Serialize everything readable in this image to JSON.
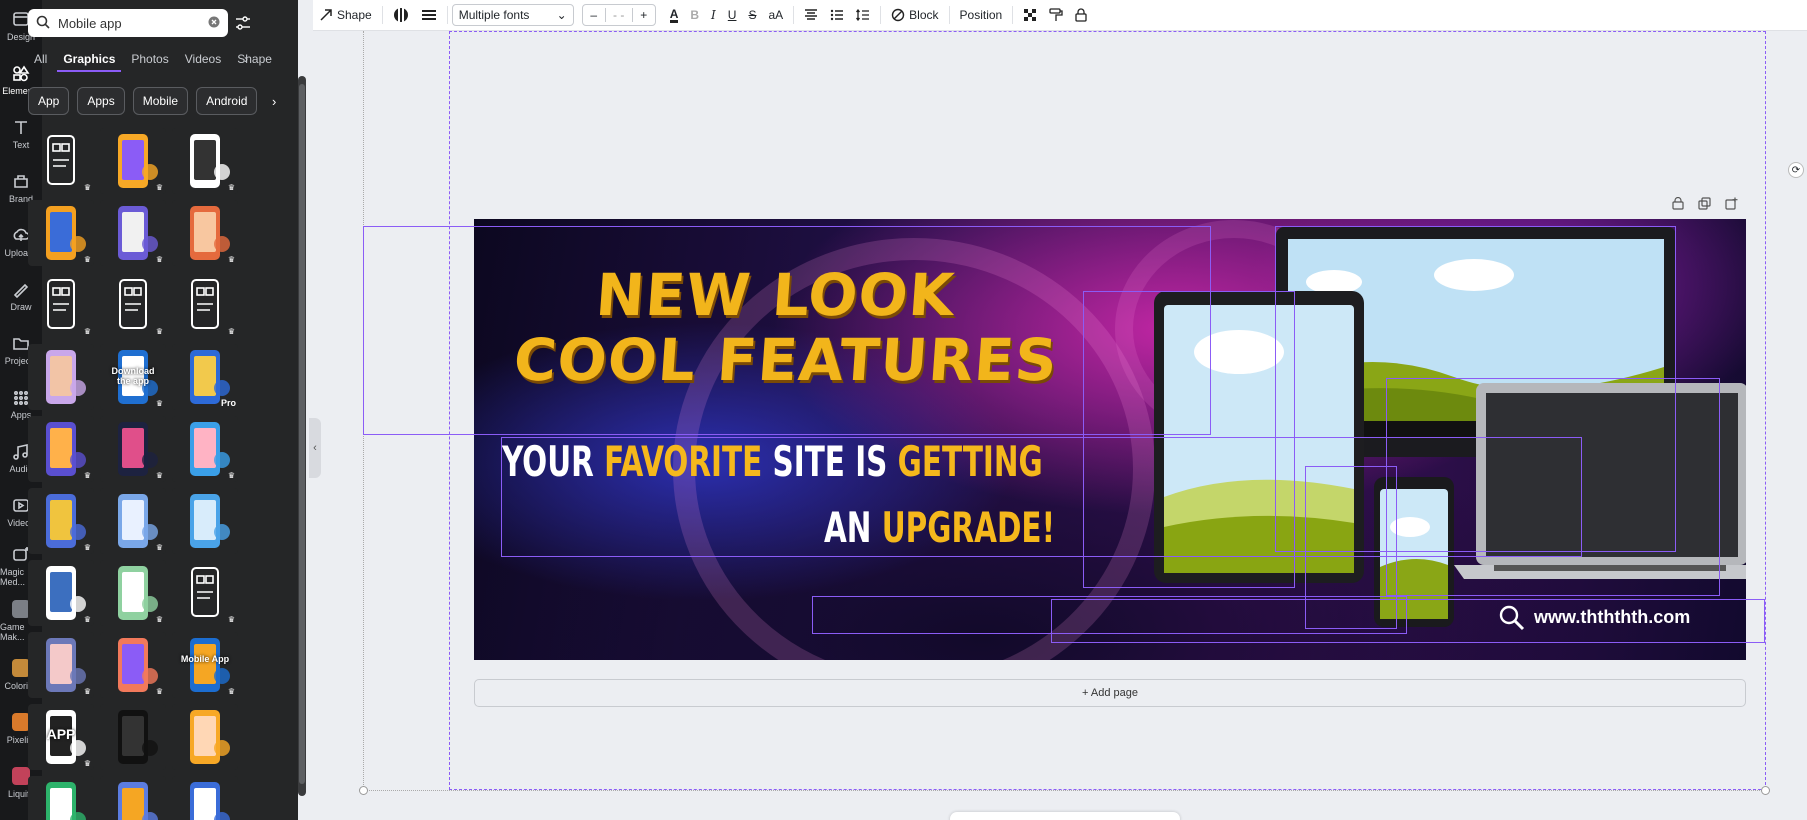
{
  "rail": {
    "items": [
      {
        "label": "Design",
        "icon": "design-icon"
      },
      {
        "label": "Elements",
        "icon": "elements-icon"
      },
      {
        "label": "Text",
        "icon": "text-icon"
      },
      {
        "label": "Brand",
        "icon": "brand-icon"
      },
      {
        "label": "Uploads",
        "icon": "uploads-icon"
      },
      {
        "label": "Draw",
        "icon": "draw-icon"
      },
      {
        "label": "Projects",
        "icon": "projects-icon"
      },
      {
        "label": "Apps",
        "icon": "apps-icon"
      },
      {
        "label": "Audio",
        "icon": "audio-icon"
      },
      {
        "label": "Videos",
        "icon": "videos-icon"
      },
      {
        "label": "Magic Med...",
        "icon": "magic-media-icon"
      },
      {
        "label": "Game Mak...",
        "icon": "game-maker-icon"
      },
      {
        "label": "Colorize",
        "icon": "colorize-icon"
      },
      {
        "label": "Pixelify",
        "icon": "pixelify-icon"
      },
      {
        "label": "Liquify",
        "icon": "liquify-icon"
      }
    ],
    "active_color": "#ffffff"
  },
  "panel": {
    "search_value": "Mobile app",
    "tabs": [
      "All",
      "Graphics",
      "Photos",
      "Videos",
      "Shape"
    ],
    "active_tab": "Graphics",
    "chips": [
      "App",
      "Apps",
      "Mobile",
      "Android"
    ],
    "tiles": [
      {
        "kind": "outline-phone-tap",
        "badge": "crown"
      },
      {
        "kind": "3d-phone-megaphone",
        "badge": "crown"
      },
      {
        "kind": "hand-phone-check",
        "badge": "crown"
      },
      {
        "kind": "phone-list",
        "badge": "crown"
      },
      {
        "kind": "app-grid-people",
        "badge": "crown"
      },
      {
        "kind": "3d-phone-orange",
        "badge": "crown"
      },
      {
        "kind": "devices-check",
        "badge": "crown"
      },
      {
        "kind": "phone-check-outline",
        "badge": "crown"
      },
      {
        "kind": "tablet-apps-outline",
        "badge": "crown"
      },
      {
        "kind": "hands-phone",
        "badge": "none"
      },
      {
        "kind": "download-the-app",
        "badge": "crown",
        "text": "Download the app"
      },
      {
        "kind": "app-cards",
        "badge": "pro",
        "text": "Pro"
      },
      {
        "kind": "phone-people",
        "badge": "crown"
      },
      {
        "kind": "phone-dark",
        "badge": "crown"
      },
      {
        "kind": "person-phone-3d",
        "badge": "crown"
      },
      {
        "kind": "team-phone",
        "badge": "crown"
      },
      {
        "kind": "tablet-person",
        "badge": "crown"
      },
      {
        "kind": "tablet-flat",
        "badge": "none"
      },
      {
        "kind": "man-phone",
        "badge": "crown"
      },
      {
        "kind": "phone-green-ui",
        "badge": "crown"
      },
      {
        "kind": "phone-user-outline",
        "badge": "crown"
      },
      {
        "kind": "app-dashboard",
        "badge": "crown"
      },
      {
        "kind": "hand-phone-money",
        "badge": "crown"
      },
      {
        "kind": "mobile-app-gear",
        "badge": "crown",
        "text": "Mobile App"
      },
      {
        "kind": "app-window",
        "badge": "crown",
        "text": "APP"
      },
      {
        "kind": "phone-black",
        "badge": "none"
      },
      {
        "kind": "hands-phone-orange",
        "badge": "none"
      },
      {
        "kind": "phone-green",
        "badge": "none"
      },
      {
        "kind": "app-icons",
        "badge": "none"
      },
      {
        "kind": "phone-grid-blue",
        "badge": "none"
      }
    ]
  },
  "toolbar": {
    "shape_label": "Shape",
    "font_value": "Multiple fonts",
    "size_minus": "–",
    "size_value": "- -",
    "size_plus": "+",
    "bold": "B",
    "italic": "I",
    "underline": "U",
    "strike": "S",
    "case": "aA",
    "block_label": "Block",
    "position_label": "Position"
  },
  "canvas": {
    "headline_line1": "NEW LOOK",
    "headline_line2": "COOL FEATURES",
    "sub_line1": [
      {
        "text": "YOUR ",
        "color": "white"
      },
      {
        "text": "FAVORITE ",
        "color": "yellow"
      },
      {
        "text": "SITE IS ",
        "color": "white"
      },
      {
        "text": "GETTING",
        "color": "yellow"
      }
    ],
    "sub_line2": [
      {
        "text": "AN ",
        "color": "white"
      },
      {
        "text": "UPGRADE!",
        "color": "yellow"
      }
    ],
    "url": "www.thththth.com",
    "add_page": "+ Add page",
    "colors": {
      "headline": "#f2b51b",
      "accent_purple": "#8b5cf6",
      "banner_dark": "#120a2e"
    }
  }
}
